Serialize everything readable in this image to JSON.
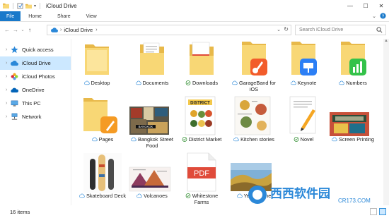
{
  "window": {
    "title": "iCloud Drive",
    "controls": [
      "minimize",
      "maximize",
      "close"
    ]
  },
  "ribbon": {
    "tabs": [
      "File",
      "Home",
      "Share",
      "View"
    ]
  },
  "address_bar": {
    "crumb": "iCloud Drive",
    "search_placeholder": "Search iCloud Drive"
  },
  "sidebar": {
    "items": [
      {
        "label": "Quick access",
        "icon": "star-icon"
      },
      {
        "label": "iCloud Drive",
        "icon": "cloud-icon",
        "selected": true
      },
      {
        "label": "iCloud Photos",
        "icon": "photos-icon"
      },
      {
        "label": "OneDrive",
        "icon": "onedrive-icon"
      },
      {
        "label": "This PC",
        "icon": "pc-icon"
      },
      {
        "label": "Network",
        "icon": "network-icon"
      }
    ]
  },
  "files": [
    {
      "name": "Desktop",
      "type": "folder",
      "status": "cloud"
    },
    {
      "name": "Documents",
      "type": "folder-docs",
      "status": "cloud"
    },
    {
      "name": "Downloads",
      "type": "folder-pdf",
      "status": "synced"
    },
    {
      "name": "GarageBand for iOS",
      "type": "folder-garageband",
      "status": "cloud"
    },
    {
      "name": "Keynote",
      "type": "folder-keynote",
      "status": "cloud"
    },
    {
      "name": "Numbers",
      "type": "folder-numbers",
      "status": "cloud"
    },
    {
      "name": "Pages",
      "type": "folder-pages",
      "status": "cloud"
    },
    {
      "name": "Bangkok Street Food",
      "type": "image",
      "status": "cloud"
    },
    {
      "name": "District Market",
      "type": "image",
      "status": "synced"
    },
    {
      "name": "Kitchen stories",
      "type": "image",
      "status": "cloud"
    },
    {
      "name": "Novel",
      "type": "doc",
      "status": "synced"
    },
    {
      "name": "Screen Printing",
      "type": "image",
      "status": "cloud"
    },
    {
      "name": "Skateboard Deck",
      "type": "image",
      "status": "cloud"
    },
    {
      "name": "Volcanoes",
      "type": "image",
      "status": "cloud"
    },
    {
      "name": "Whitestone Farms",
      "type": "pdf",
      "status": "synced"
    },
    {
      "name": "Yellowstone",
      "type": "image",
      "status": "cloud"
    }
  ],
  "thumb_text": {
    "pdf": "PDF",
    "district": "DISTRICT",
    "bangkok": "BANGKOK"
  },
  "status_bar": {
    "count": "16 items"
  },
  "watermark": {
    "text": "西西软件园",
    "url": "CR173.COM"
  },
  "colors": {
    "accent": "#1979ca",
    "folder": "#f8d775",
    "selected": "#cce8ff"
  }
}
